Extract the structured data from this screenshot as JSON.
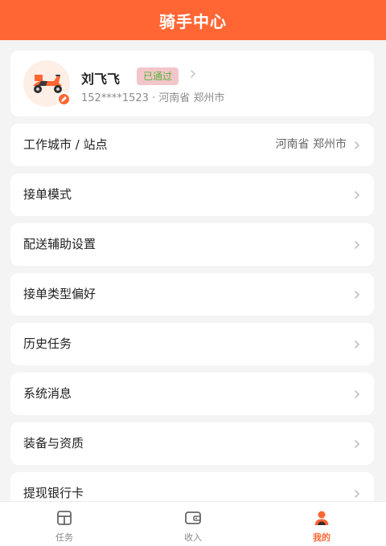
{
  "header": {
    "title": "骑手中心"
  },
  "profile": {
    "name": "刘飞飞",
    "status": "已通过",
    "phone_location": "152****1523 · 河南省 郑州市"
  },
  "menu": [
    {
      "label": "工作城市 / 站点",
      "value": "河南省 郑州市"
    },
    {
      "label": "接单模式",
      "value": ""
    },
    {
      "label": "配送辅助设置",
      "value": ""
    },
    {
      "label": "接单类型偏好",
      "value": ""
    },
    {
      "label": "历史任务",
      "value": ""
    },
    {
      "label": "系统消息",
      "value": ""
    },
    {
      "label": "装备与资质",
      "value": ""
    },
    {
      "label": "提现银行卡",
      "value": ""
    }
  ],
  "tabbar": {
    "tabs": [
      {
        "label": "任务",
        "icon": "task-icon"
      },
      {
        "label": "收入",
        "icon": "wallet-icon"
      },
      {
        "label": "我的",
        "icon": "user-icon"
      }
    ],
    "active_index": 2
  },
  "colors": {
    "accent": "#ff6633",
    "badge_bg": "#f3c6c9",
    "badge_text": "#58b338",
    "background": "#f4f4f4"
  }
}
